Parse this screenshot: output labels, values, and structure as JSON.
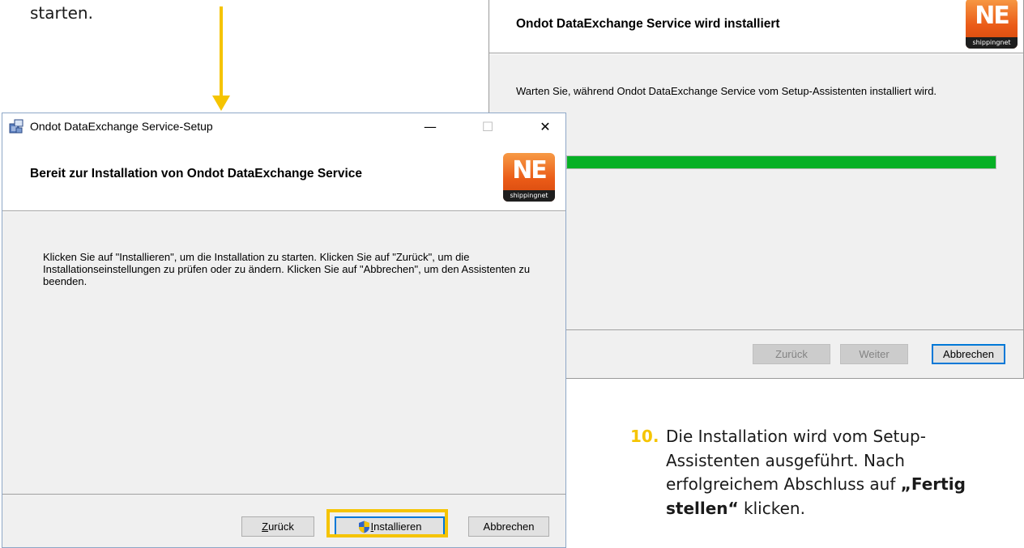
{
  "doc": {
    "top_text": "starten.",
    "step_number": "10.",
    "step_text_1": "Die Installation wird vom Setup-Assistenten ausgeführt. Nach erfolgreichem Abschluss auf ",
    "step_text_bold": "„Fertig stellen“",
    "step_text_2": " klicken."
  },
  "logo": {
    "mark": "NE",
    "foot": "shippingnet"
  },
  "back_window": {
    "header_title": "Ondot DataExchange Service wird installiert",
    "body_text": "Warten Sie, während Ondot DataExchange Service vom Setup-Assistenten installiert wird.",
    "progress_fraction": 1.0,
    "buttons": {
      "back": "Zurück",
      "next": "Weiter",
      "cancel": "Abbrechen"
    }
  },
  "front_window": {
    "title": "Ondot DataExchange Service-Setup",
    "controls": {
      "minimize": "—",
      "maximize": "☐",
      "close": "✕"
    },
    "header_title": "Bereit zur Installation von Ondot DataExchange Service",
    "body_text": "Klicken Sie auf \"Installieren\", um die Installation zu starten. Klicken Sie auf \"Zurück\", um die Installationseinstellungen zu prüfen oder zu ändern. Klicken Sie auf \"Abbrechen\", um den Assistenten zu beenden.",
    "buttons": {
      "back_prefix": "Z",
      "back_rest": "urück",
      "install_prefix": "I",
      "install_rest": "nstallieren",
      "cancel": "Abbrechen"
    }
  },
  "colors": {
    "accent_yellow": "#f5c400",
    "progress_green": "#06b025",
    "logo_orange": "#ea5a17"
  },
  "icons": [
    "installer-icon",
    "shield-icon",
    "arrow-down-icon"
  ]
}
